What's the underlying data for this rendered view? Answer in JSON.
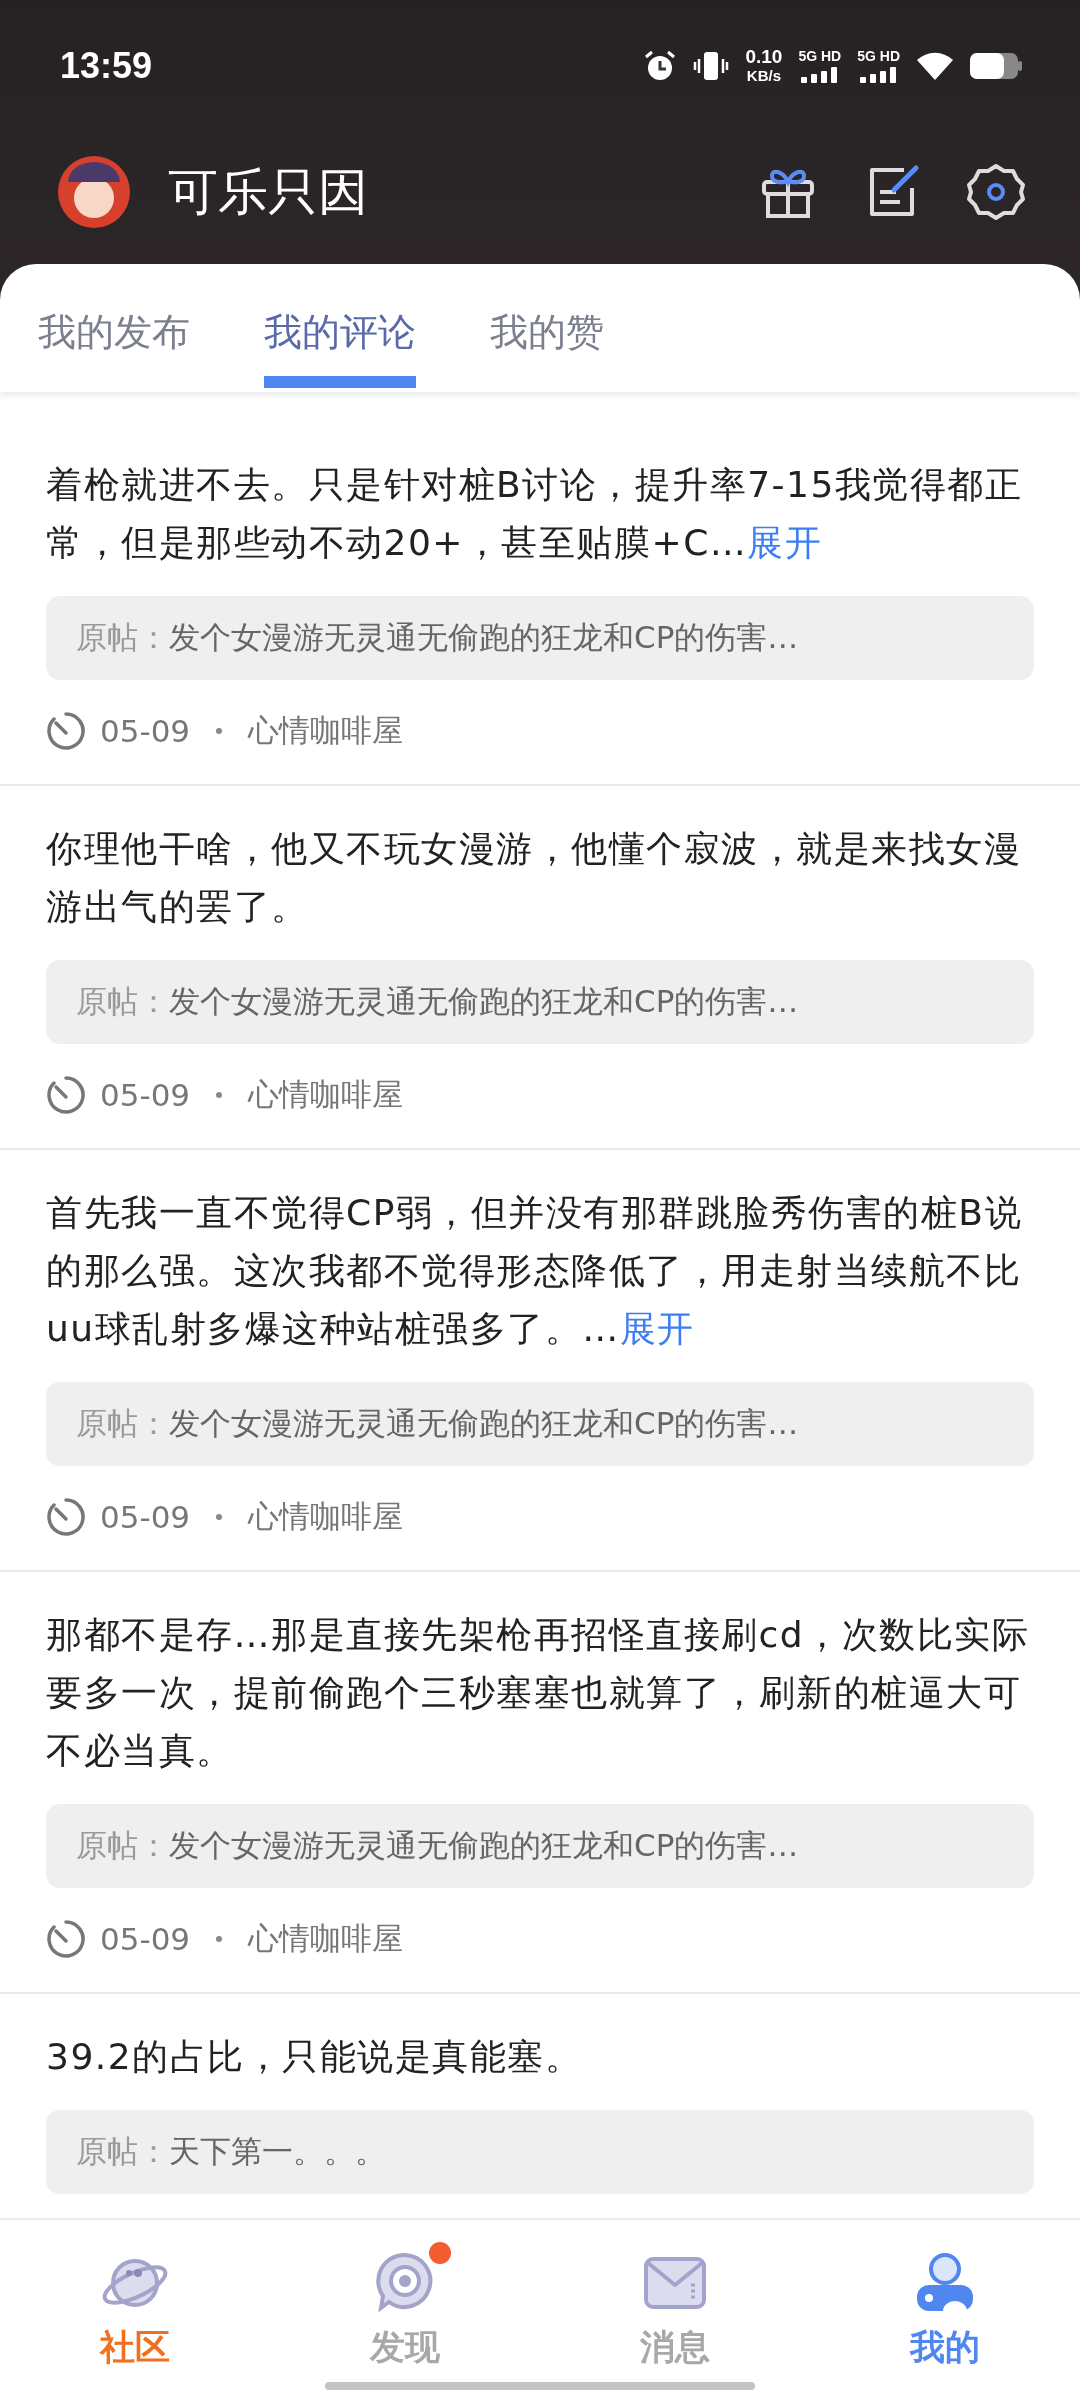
{
  "status_bar": {
    "time": "13:59",
    "net_speed": "0.10",
    "net_unit": "KB/s",
    "sim_labels": [
      "5G HD",
      "5G HD"
    ]
  },
  "profile": {
    "name": "可乐只因"
  },
  "tabs": [
    {
      "label": "我的发布",
      "selected": false
    },
    {
      "label": "我的评论",
      "selected": true
    },
    {
      "label": "我的赞",
      "selected": false
    }
  ],
  "comments": [
    {
      "text": "着枪就进不去。只是针对桩B讨论，提升率7-15我觉得都正常，但是那些动不动20+，甚至贴膜+C…",
      "expand": "展开",
      "quote_label": "原帖：",
      "quote": "发个女漫游无灵通无偷跑的狂龙和CP的伤害…",
      "date": "05-09",
      "board": "心情咖啡屋"
    },
    {
      "text": "你理他干啥，他又不玩女漫游，他懂个寂波，就是来找女漫游出气的罢了。",
      "quote_label": "原帖：",
      "quote": "发个女漫游无灵通无偷跑的狂龙和CP的伤害…",
      "date": "05-09",
      "board": "心情咖啡屋"
    },
    {
      "text": "首先我一直不觉得CP弱，但并没有那群跳脸秀伤害的桩B说的那么强。这次我都不觉得形态降低了，用走射当续航不比uu球乱射多爆这种站桩强多了。…",
      "expand": "展开",
      "quote_label": "原帖：",
      "quote": "发个女漫游无灵通无偷跑的狂龙和CP的伤害…",
      "date": "05-09",
      "board": "心情咖啡屋"
    },
    {
      "text": "那都不是存…那是直接先架枪再招怪直接刷cd，次数比实际要多一次，提前偷跑个三秒塞塞也就算了，刷新的桩逼大可不必当真。",
      "quote_label": "原帖：",
      "quote": "发个女漫游无灵通无偷跑的狂龙和CP的伤害…",
      "date": "05-09",
      "board": "心情咖啡屋"
    },
    {
      "text": "39.2的占比，只能说是真能塞。",
      "quote_label": "原帖：",
      "quote": "天下第一。。。"
    }
  ],
  "bottom_nav": [
    {
      "label": "社区",
      "kind": "planet",
      "color": "#f07020",
      "badge": false
    },
    {
      "label": "发现",
      "kind": "discover",
      "color": "#a8a8a8",
      "badge": true
    },
    {
      "label": "消息",
      "kind": "mail",
      "color": "#a8a8a8",
      "badge": false
    },
    {
      "label": "我的",
      "kind": "user",
      "color": "#4f86f0",
      "badge": false
    }
  ]
}
